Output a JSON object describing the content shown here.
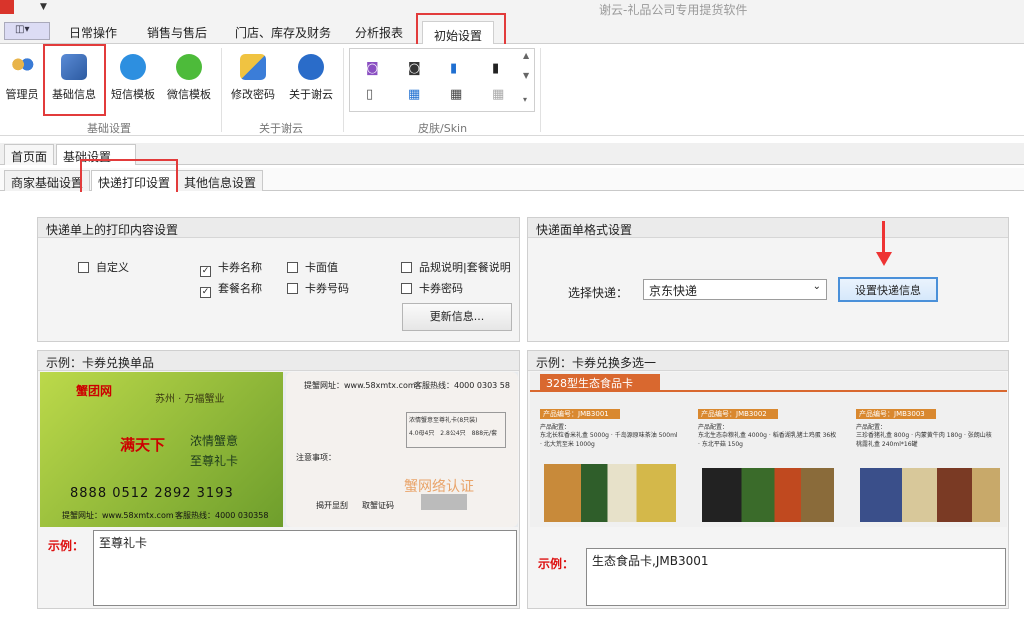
{
  "window": {
    "title": "谢云-礼品公司专用提货软件"
  },
  "menu_tabs": [
    "日常操作",
    "销售与售后",
    "门店、库存及财务",
    "分析报表",
    "初始设置"
  ],
  "ribbon": {
    "groups": {
      "basic": "基础设置",
      "about": "关于谢云",
      "skin": "皮肤/Skin"
    },
    "buttons": [
      "管理员",
      "基础信息",
      "短信模板",
      "微信模板",
      "修改密码",
      "关于谢云"
    ]
  },
  "doc_tabs": [
    "首页面",
    "基础设置",
    "×"
  ],
  "sub_tabs": [
    "商家基础设置",
    "快递打印设置",
    "其他信息设置"
  ],
  "print_panel": {
    "title": "快递单上的打印内容设置",
    "checkboxes": [
      {
        "label": "自定义",
        "checked": false
      },
      {
        "label": "卡券名称",
        "checked": true
      },
      {
        "label": "卡面值",
        "checked": false
      },
      {
        "label": "品规说明|套餐说明",
        "checked": false
      },
      {
        "label": "套餐名称",
        "checked": true
      },
      {
        "label": "卡券号码",
        "checked": false
      },
      {
        "label": "卡券密码",
        "checked": false
      }
    ],
    "update_button": "更新信息..."
  },
  "format_panel": {
    "title": "快递面单格式设置",
    "select_label": "选择快递：",
    "select_value": "京东快递",
    "set_button": "设置快递信息"
  },
  "example_left": {
    "title": "示例：卡券兑换单品",
    "label": "示例：",
    "value": "至尊礼卡",
    "card_front": {
      "brand": "蟹团网",
      "region": "苏州 · 万福蟹业",
      "slogan": "满天下",
      "sub": "浓情蟹意",
      "sub2": "至尊礼卡",
      "phone": "8888 0512 2892 3193",
      "site": "提蟹网址：www.58xmtx.com",
      "hotline": "客服热线：4000 030358"
    },
    "card_back": {
      "site": "提蟹网址：www.58xmtx.com",
      "hotline": "客服热线：4000 0303 58",
      "note": "注意事项：",
      "open": "揭开显刮",
      "code": "取蟹证码",
      "watermark": "蟹网络认证",
      "table": [
        "浓情蟹意至尊礼卡(8只装)",
        "4.0母4只",
        "2.8公4只",
        "888元/套"
      ]
    }
  },
  "example_right": {
    "title": "示例：卡券兑换多选一",
    "label": "示例：",
    "value": "生态食品卡,JMB3001",
    "banner": "328型生态食品卡",
    "products": [
      {
        "code": "产品编号：JMB3001",
        "config": "产品配置：",
        "items": "东北长粒香米礼盒 5000g · 千岛源原味茶油 500ml · 北大荒至米 1000g"
      },
      {
        "code": "产品编号：JMB3002",
        "config": "产品配置：",
        "items": "东北生态杂粮礼盒 4000g · 稻香湖乳猪土鸡蛋 36枚 · 东北平菇 150g"
      },
      {
        "code": "产品编号：JMB3003",
        "config": "产品配置：",
        "items": "三珍香猪礼盒 800g · 内蒙黄牛肉 180g · 张朗山核桃露礼盒 240ml*16罐"
      }
    ]
  }
}
